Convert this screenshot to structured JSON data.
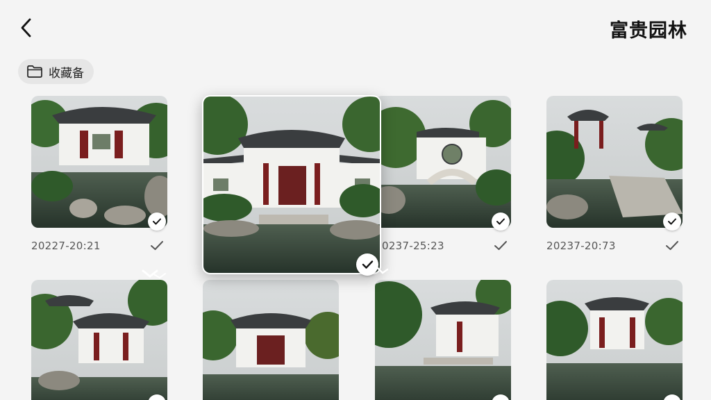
{
  "header": {
    "title": "富贵园林",
    "back_icon": "chevron-left-icon"
  },
  "album_chip": {
    "label": "收藏备",
    "icon": "folder-icon"
  },
  "photos": [
    {
      "id": "photo-1",
      "date": "20227-20:21",
      "selected": true,
      "scene": "pavilion-pond"
    },
    {
      "id": "photo-2",
      "date": "",
      "selected": true,
      "featured": true,
      "scene": "hall-reflection"
    },
    {
      "id": "photo-3",
      "date": "0237-25:23",
      "selected": true,
      "scene": "moon-gate-bridge"
    },
    {
      "id": "photo-4",
      "date": "20237-20:73",
      "selected": true,
      "scene": "pavilion-path"
    },
    {
      "id": "photo-5",
      "date": "",
      "selected": true,
      "scene": "pavilion-pond"
    },
    {
      "id": "photo-6",
      "date": "",
      "selected": true,
      "scene": "hall-reflection"
    },
    {
      "id": "photo-7",
      "date": "",
      "selected": true,
      "scene": "pavilion-bridge"
    },
    {
      "id": "photo-8",
      "date": "",
      "selected": true,
      "scene": "hall-reflection"
    }
  ],
  "colors": {
    "background": "#f4f4f4",
    "chip_bg": "#e6e6e6",
    "roof": "#3a3d3f",
    "wall": "#f2f2ef",
    "pillar": "#7a1e1e",
    "foliage": "#2f5a2a",
    "water": "#36463a"
  }
}
